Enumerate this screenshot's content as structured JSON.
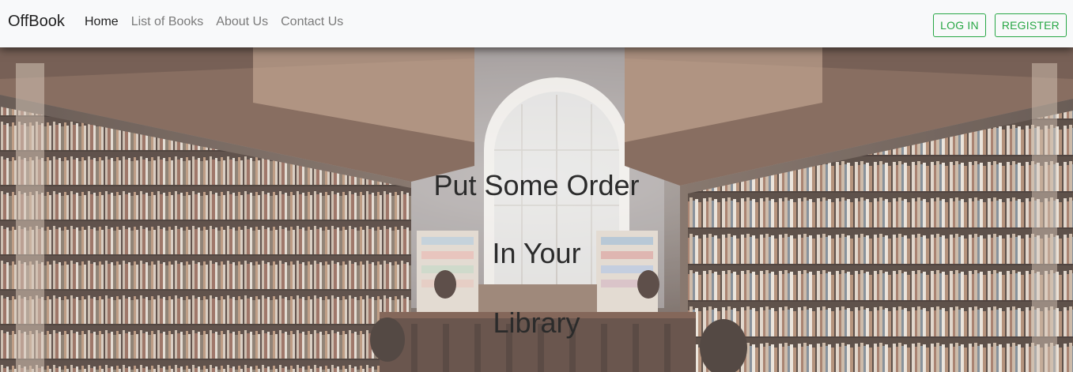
{
  "navbar": {
    "brand": "OffBook",
    "links": [
      {
        "label": "Home",
        "active": true
      },
      {
        "label": "List of Books",
        "active": false
      },
      {
        "label": "About Us",
        "active": false
      },
      {
        "label": "Contact Us",
        "active": false
      }
    ],
    "login_label": "LOG IN",
    "register_label": "REGISTER"
  },
  "hero": {
    "lines": [
      "Put Some Order",
      "In Your",
      "Library"
    ],
    "background": "library-bookshelves-image"
  },
  "colors": {
    "accent": "#28a745",
    "navbar_bg": "#f8f9fa"
  }
}
